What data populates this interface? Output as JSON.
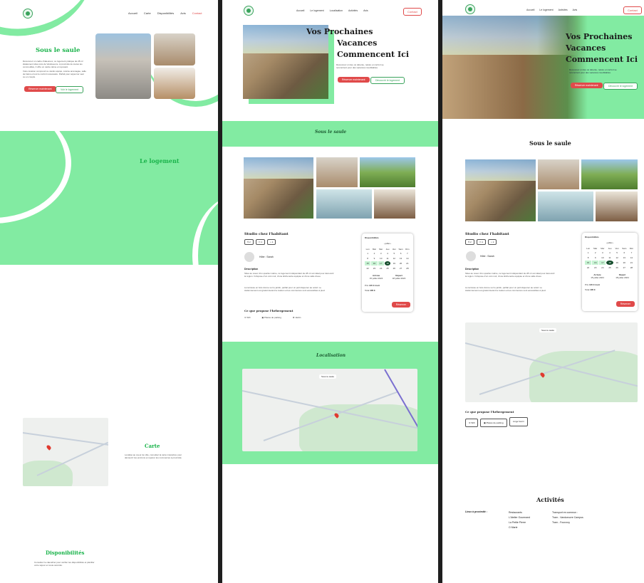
{
  "nav": {
    "accueil": "Accueil",
    "carte": "Carte",
    "disponibilites": "Disponibilités",
    "avis": "Avis",
    "contact": "Contact"
  },
  "nav2": {
    "accueil": "Accueil",
    "logement": "Le logement",
    "localisation": "Localisation",
    "activites": "Activités",
    "avis": "Avis",
    "contact": "Contact"
  },
  "hero": {
    "title_l1": "Vos Prochaines",
    "title_l2": "Vacances",
    "title_l3": "Commencent Ici",
    "text": "Découvrez un lieu où détente, nature et confort se rencontrent pour des vacances inoubliables.",
    "reserve": "Réserver maintenant",
    "decouvrir": "Découvrir le logement"
  },
  "c1": {
    "title": "Sous le saule",
    "p1": "Découvrez un cadre chaleureux, ce logement pratique de 28 m² idéalement situé près de Vandoeuvre. A proximité de toutes les commodités, il offre un cadre calme et reposant.",
    "p2": "Votre location comprend ce studio équipé, cuisine aménagée, salle de bains et tout le confort nécessaire. Parfait pour séjourner seul ou en couple.",
    "reserve": "Réserver maintenant",
    "decouvrir": "Voir le logement",
    "logement": "Le logement",
    "carte": "Carte",
    "carte_text": "Localisé au coeur de ville, consultez la carte interactive pour découvrir les environs et repérer les commerces à proximité.",
    "dispo": "Disponibilités",
    "dispo_text": "Consultez le calendrier pour vérifier les disponibilités et planifier votre séjour en toute sérénité."
  },
  "listing": {
    "section": "Sous le saule",
    "title": "Studio chez l'habitant",
    "host": "Hôte : Sarah",
    "desc_h": "Description",
    "desc1": "Situé au coeur d'un quartier calme, ce logement indépendant de 28 m² est idéal pour découvrir la région. Il dispose d'un coin nuit, d'une kitchenette équipée et d'une salle d'eau.",
    "desc2": "La terrasse en bois donne sur le jardin, parfait pour un petit déjeuner au soleil. Le stationnement est gratuit devant la maison et les commerces sont accessibles à pied.",
    "offers_h": "Ce que propose l'hébergement",
    "wifi": "Wifi",
    "parking": "Places de parking",
    "jardin": "Jardin",
    "equip": "Linge fourni"
  },
  "cal": {
    "title": "Disponibilités",
    "month": "juillet",
    "days": [
      "Lun",
      "Mar",
      "Mer",
      "Jeu",
      "Ven",
      "Sam",
      "Dim"
    ],
    "cells": [
      "1",
      "2",
      "3",
      "4",
      "5",
      "6",
      "7",
      "8",
      "9",
      "10",
      "11",
      "12",
      "13",
      "14",
      "15",
      "16",
      "17",
      "18",
      "19",
      "20",
      "21",
      "22",
      "23",
      "24",
      "25",
      "26",
      "27",
      "28"
    ],
    "arrivee": "Arrivée",
    "depart": "Départ",
    "arrivee_v": "15 juillet 2024",
    "depart_v": "18 juillet 2024",
    "prix": "Prix",
    "prix_v": "135 € /nuit",
    "total": "Total",
    "total_v": "405 €",
    "reserver": "Réserver"
  },
  "loc": {
    "section": "Localisation",
    "label": "Sous le saule"
  },
  "activites": {
    "title": "Activités",
    "col1_h": "Lieux à proximité :",
    "col2": [
      "Restaurants",
      "L'Atelier Gourmand",
      "La Petite Pierre",
      "O Marie"
    ],
    "col3": [
      "Transport en commun :",
      "Tram - Vandoeuvre Campus",
      "Tram - Fourcroy"
    ]
  },
  "colors": {
    "brand": "#19b34a",
    "accent": "#e04a4a",
    "mint": "#82eba2"
  }
}
